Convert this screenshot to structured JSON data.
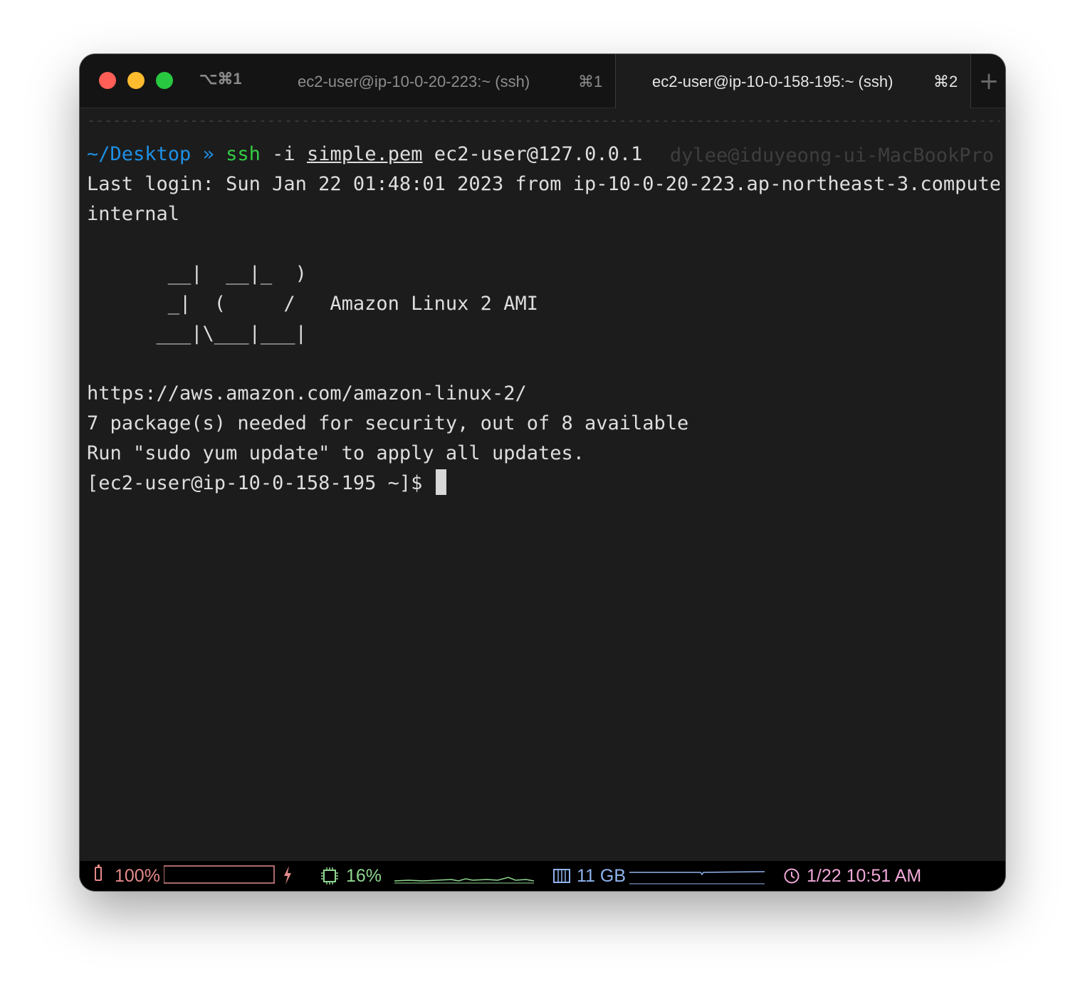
{
  "window": {
    "shortcut": "⌥⌘1",
    "new_tab_label": "+",
    "tabs": [
      {
        "title": "ec2-user@ip-10-0-20-223:~ (ssh)",
        "shortcut": "⌘1",
        "active": false
      },
      {
        "title": "ec2-user@ip-10-0-158-195:~ (ssh)",
        "shortcut": "⌘2",
        "active": true
      }
    ]
  },
  "terminal": {
    "prompt_dir": "~/Desktop",
    "prompt_sep": "»",
    "command": "ssh",
    "command_flag": "-i",
    "command_file": "simple.pem",
    "command_target": "ec2-user@127.0.0.1",
    "right_prompt": "dylee@iduyeong-ui-MacBookPro",
    "lines": [
      "Last login: Sun Jan 22 01:48:01 2023 from ip-10-0-20-223.ap-northeast-3.compute.",
      "internal",
      "",
      "       __|  __|_  )",
      "       _|  (     /   Amazon Linux 2 AMI",
      "      ___|\\___|___|",
      "",
      "https://aws.amazon.com/amazon-linux-2/",
      "7 package(s) needed for security, out of 8 available",
      "Run \"sudo yum update\" to apply all updates."
    ],
    "final_prompt": "[ec2-user@ip-10-0-158-195 ~]$ "
  },
  "status": {
    "battery": "100%",
    "battery_level": 1.0,
    "charging_icon": "lightning-icon",
    "cpu": "16%",
    "memory": "11 GB",
    "clock": "1/22 10:51 AM",
    "colors": {
      "battery": "#e58a8a",
      "cpu": "#8fd68f",
      "memory": "#8fb4f0",
      "clock": "#f0a8d8"
    }
  }
}
